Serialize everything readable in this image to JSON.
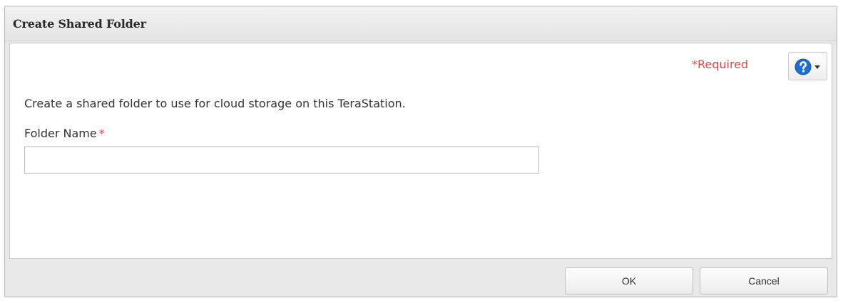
{
  "dialog": {
    "title": "Create Shared Folder"
  },
  "content": {
    "required_note": "*Required",
    "help_icon": "question-circle-icon",
    "description": "Create a shared folder to use for cloud storage on this TeraStation.",
    "folder_name": {
      "label": "Folder Name",
      "required_marker": "*",
      "value": ""
    }
  },
  "footer": {
    "ok_label": "OK",
    "cancel_label": "Cancel"
  },
  "colors": {
    "required": "#e04848",
    "help_icon_blue": "#1f6fd1"
  }
}
